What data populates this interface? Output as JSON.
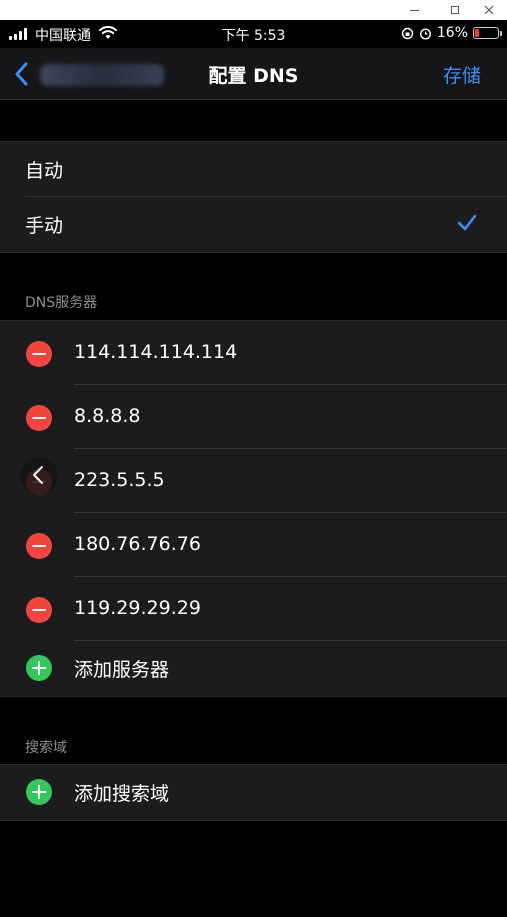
{
  "window": {
    "controls": [
      "minimize",
      "maximize",
      "close"
    ]
  },
  "status_bar": {
    "carrier": "中国联通",
    "time": "下午 5:53",
    "battery_percent": "16%",
    "battery_level": 0.16,
    "icons": [
      "signal-icon",
      "wifi-icon",
      "orientation-lock-icon",
      "alarm-icon",
      "battery-icon"
    ]
  },
  "nav": {
    "title": "配置 DNS",
    "save_label": "存储",
    "back_icon": "chevron-left-icon"
  },
  "mode": {
    "options": [
      {
        "label": "自动",
        "selected": false
      },
      {
        "label": "手动",
        "selected": true
      }
    ],
    "accent_color": "#3d8ef7"
  },
  "dns": {
    "header": "DNS服务器",
    "servers": [
      "114.114.114.114",
      "8.8.8.8",
      "223.5.5.5",
      "180.76.76.76",
      "119.29.29.29"
    ],
    "add_label": "添加服务器",
    "delete_color": "#f2453d",
    "add_color": "#34c759"
  },
  "search_domains": {
    "header": "搜索域",
    "add_label": "添加搜索域"
  }
}
